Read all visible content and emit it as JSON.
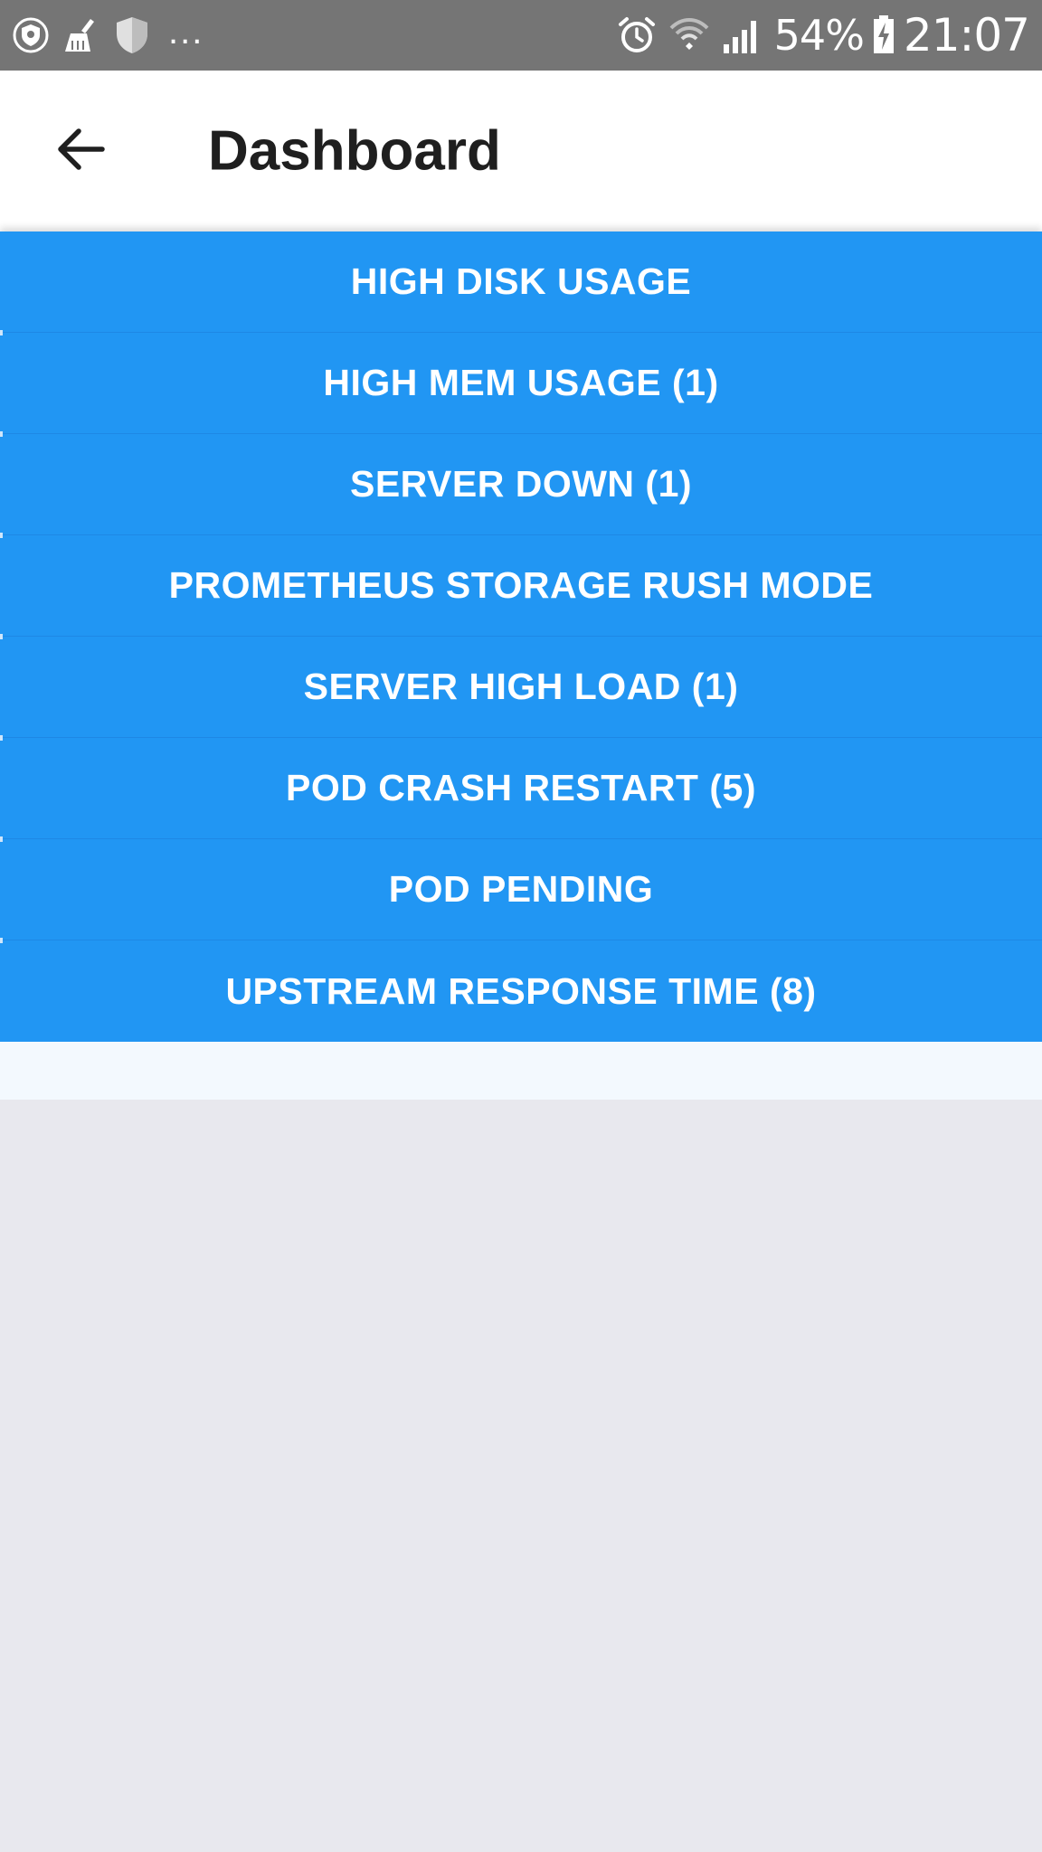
{
  "status_bar": {
    "left_icons": [
      "vpn-shield-icon",
      "cleaner-broom-icon",
      "shield-icon"
    ],
    "ellipsis": "...",
    "right_icons": [
      "alarm-icon",
      "wifi-icon",
      "signal-icon",
      "battery-charging-icon"
    ],
    "battery_percent": "54%",
    "time": "21:07"
  },
  "app_bar": {
    "back_icon": "arrow-back-icon",
    "title": "Dashboard"
  },
  "alerts": [
    {
      "label": "HIGH DISK USAGE"
    },
    {
      "label": "HIGH MEM USAGE (1)"
    },
    {
      "label": "SERVER DOWN (1)"
    },
    {
      "label": "PROMETHEUS STORAGE RUSH MODE"
    },
    {
      "label": "SERVER HIGH LOAD (1)"
    },
    {
      "label": "POD CRASH RESTART (5)"
    },
    {
      "label": "POD PENDING"
    },
    {
      "label": "UPSTREAM RESPONSE TIME (8)"
    }
  ],
  "colors": {
    "status_bar": "#757575",
    "app_bar": "#ffffff",
    "alert_button": "#2196f3",
    "background": "#e8e8ee"
  }
}
